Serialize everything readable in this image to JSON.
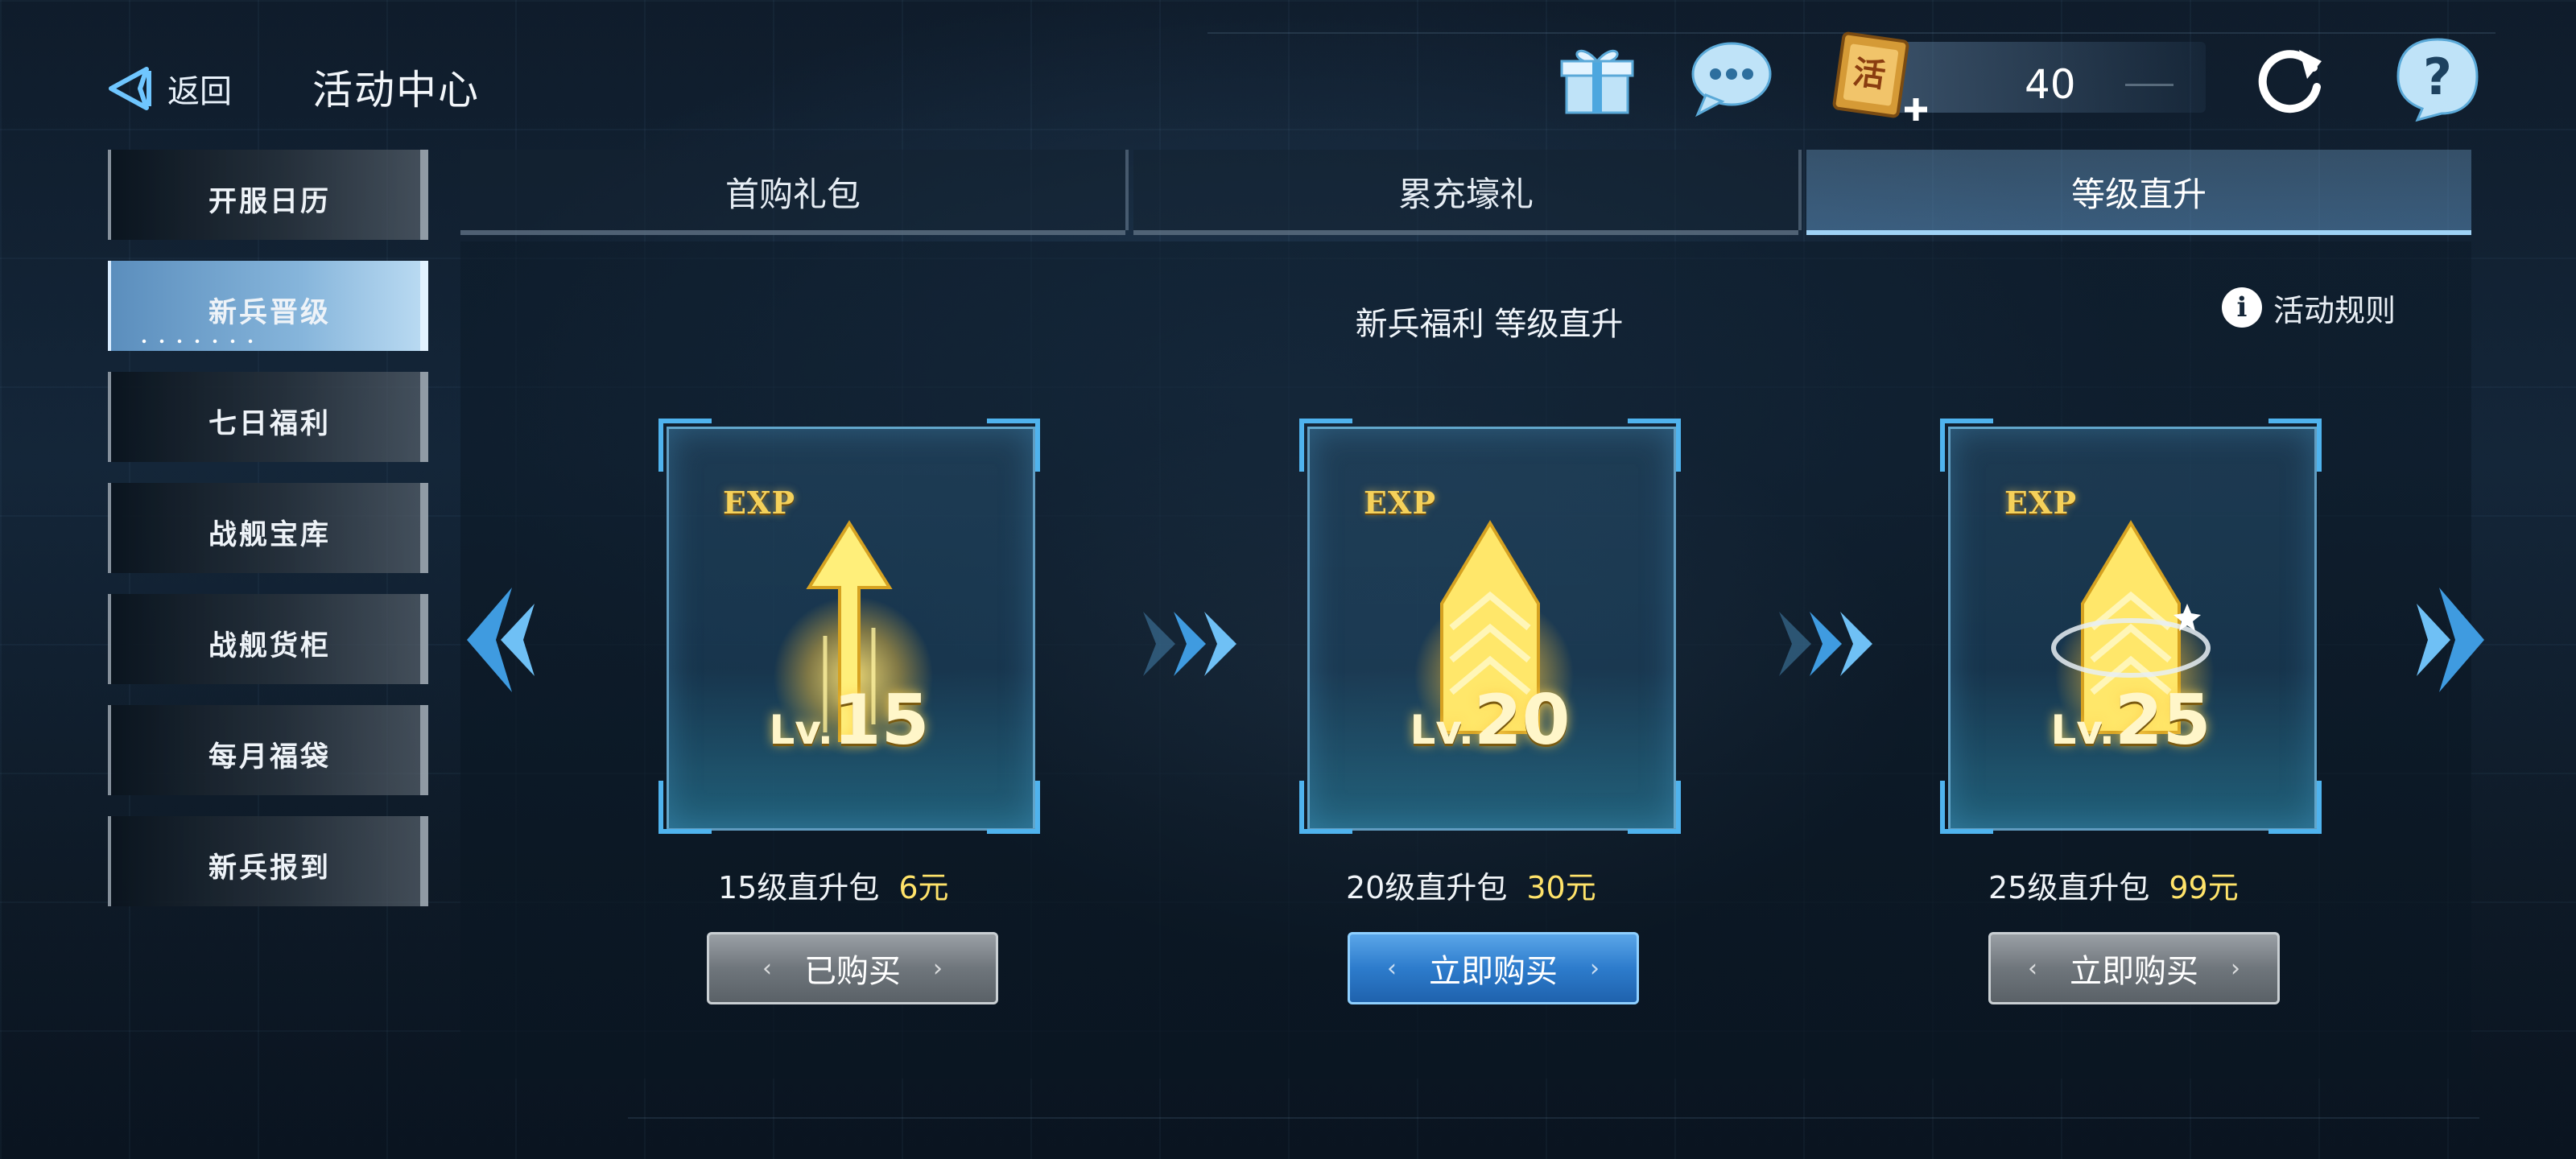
{
  "header": {
    "back_label": "返回",
    "title": "活动中心",
    "currency_value": "40",
    "icons": [
      "gift-icon",
      "chat-icon",
      "ticket-icon",
      "refresh-icon",
      "help-icon"
    ]
  },
  "sidebar": {
    "items": [
      {
        "label": "开服日历",
        "active": false
      },
      {
        "label": "新兵晋级",
        "active": true
      },
      {
        "label": "七日福利",
        "active": false
      },
      {
        "label": "战舰宝库",
        "active": false
      },
      {
        "label": "战舰货柜",
        "active": false
      },
      {
        "label": "每月福袋",
        "active": false
      },
      {
        "label": "新兵报到",
        "active": false
      }
    ]
  },
  "tabs": [
    {
      "label": "首购礼包",
      "active": false
    },
    {
      "label": "累充壕礼",
      "active": false
    },
    {
      "label": "等级直升",
      "active": true
    }
  ],
  "content": {
    "subtitle": "新兵福利 等级直升",
    "rules_label": "活动规则",
    "cards": [
      {
        "exp": "EXP",
        "lv_prefix": "Lv.",
        "level": "15",
        "name": "15级直升包",
        "price": "6元",
        "button": "已购买",
        "button_style": "grey"
      },
      {
        "exp": "EXP",
        "lv_prefix": "Lv.",
        "level": "20",
        "name": "20级直升包",
        "price": "30元",
        "button": "立即购买",
        "button_style": "blue"
      },
      {
        "exp": "EXP",
        "lv_prefix": "Lv.",
        "level": "25",
        "name": "25级直升包",
        "price": "99元",
        "button": "立即购买",
        "button_style": "grey"
      }
    ]
  },
  "colors": {
    "accent_blue": "#4fb3ee",
    "price_yellow": "#ffe36a",
    "exp_gold": "#f5d15a"
  }
}
